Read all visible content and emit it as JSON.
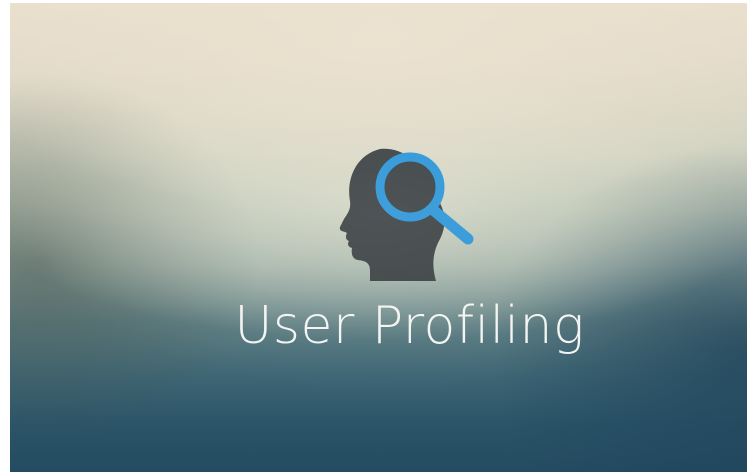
{
  "banner": {
    "title": "User Profiling",
    "icon": "head-with-magnifier-icon",
    "colors": {
      "icon_head": "#3f4547",
      "icon_lens": "#2f97d8",
      "title_text": "#f4f4f2",
      "background_top": "#e9dfcd",
      "background_bottom": "#244b60"
    }
  }
}
